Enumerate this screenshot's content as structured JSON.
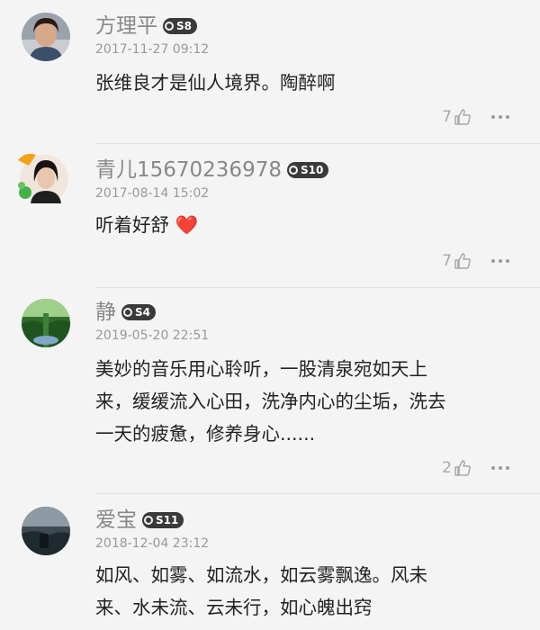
{
  "comments": [
    {
      "name": "方理平",
      "badge": "S8",
      "date": "2017-11-27 09:12",
      "text": "张维良才是仙人境界。陶醉啊",
      "likes": "7",
      "avatar_icon": "person-photo-avatar"
    },
    {
      "name": "青儿15670236978",
      "badge": "S10",
      "date": "2017-08-14 15:02",
      "text": "听着好舒 ❤️",
      "likes": "7",
      "avatar_icon": "person-photo-avatar-with-sticker"
    },
    {
      "name": "静",
      "badge": "S4",
      "date": "2019-05-20 22:51",
      "text": "美妙的音乐用心聆听，一股清泉宛如天上\n来，缓缓流入心田，洗净内心的尘垢，洗去\n一天的疲惫，修养身心......",
      "likes": "2",
      "avatar_icon": "forest-photo-avatar"
    },
    {
      "name": "爱宝",
      "badge": "S11",
      "date": "2018-12-04 23:12",
      "text": "如风、如雾、如流水，如云雾飘逸。风未\n来、水未流、云未行，如心魄出窍",
      "likes": "",
      "avatar_icon": "landscape-photo-avatar"
    }
  ],
  "colors": {
    "background": "#f4f4f4",
    "name": "#888888",
    "badge": "#3a3a3a",
    "heart": "#e0242a"
  }
}
